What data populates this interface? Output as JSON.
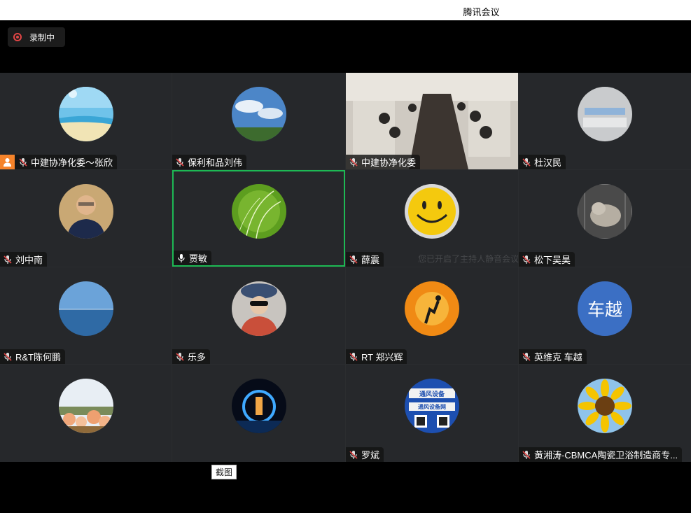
{
  "window": {
    "title": "腾讯会议"
  },
  "recording": {
    "label": "录制中"
  },
  "participants": [
    {
      "name": "中建协净化委～张欣",
      "host": true
    },
    {
      "name": "保利和品刘伟"
    },
    {
      "name": "中建协净化委"
    },
    {
      "name": "杜汉民"
    },
    {
      "name": "刘中南"
    },
    {
      "name": "贾敏",
      "speaking": true
    },
    {
      "name": "薛震"
    },
    {
      "name": "松下吴昊"
    },
    {
      "name": "R&T陈何鹏"
    },
    {
      "name": "乐多"
    },
    {
      "name": "RT 郑兴辉"
    },
    {
      "name": "英维克 车越",
      "avatar_text": "车越"
    },
    {
      "name": ""
    },
    {
      "name": ""
    },
    {
      "name": "罗斌"
    },
    {
      "name": "黄湘涛-CBMCA陶瓷卫浴制造商专..."
    }
  ],
  "overlay_ghost_text": "您已开启了主持人静音会议",
  "avatar_qr_text": {
    "line1": "通风设备",
    "line2": "通风设备网"
  },
  "screenshot_button": {
    "label": "截图"
  },
  "colors": {
    "speaking_border": "#1db954",
    "host_badge": "#f5832a",
    "record_red": "#e04545",
    "avatar_blue": "#3b6fc4"
  }
}
